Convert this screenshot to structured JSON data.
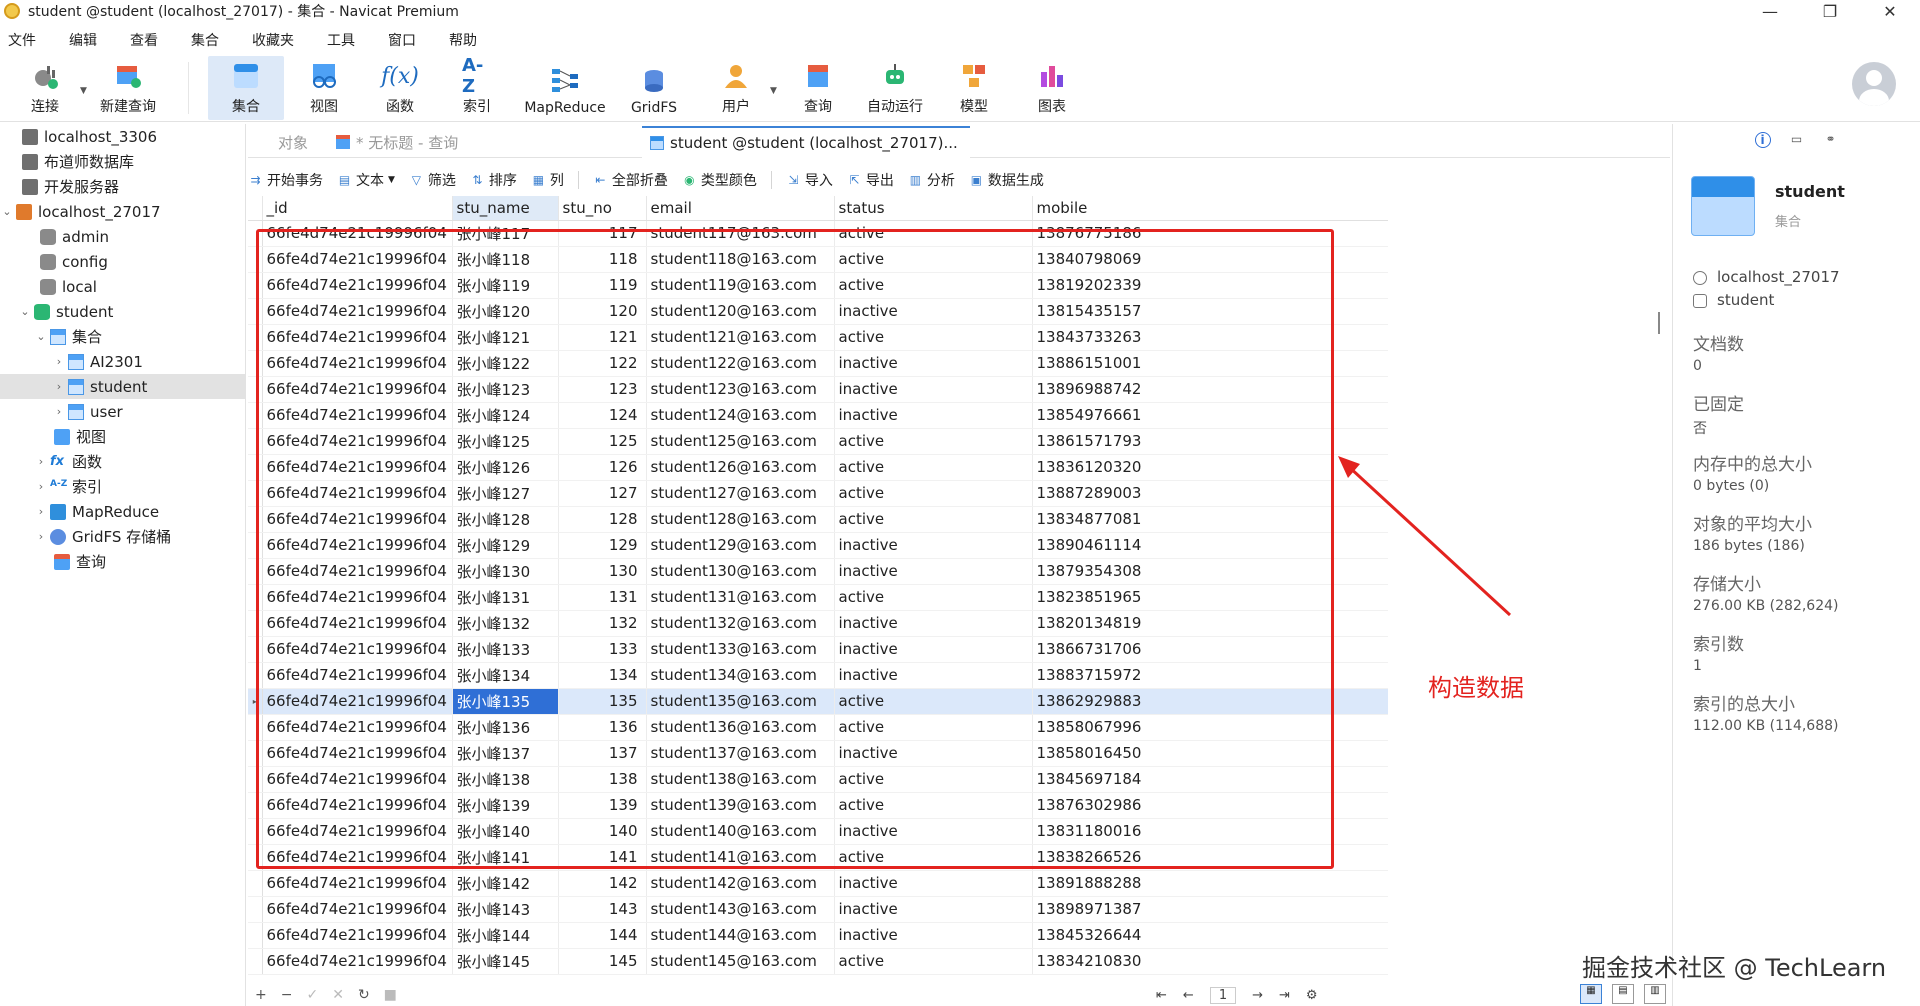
{
  "window": {
    "title": "student @student (localhost_27017) - 集合 - Navicat Premium",
    "controls": [
      "—",
      "❐",
      "✕"
    ]
  },
  "menu": [
    "文件",
    "编辑",
    "查看",
    "集合",
    "收藏夹",
    "工具",
    "窗口",
    "帮助"
  ],
  "toolbar": {
    "buttons": [
      {
        "label": "连接",
        "icon": "plug-icon"
      },
      {
        "label": "新建查询",
        "icon": "new-query-icon"
      },
      {
        "label": "集合",
        "icon": "collection-icon"
      },
      {
        "label": "视图",
        "icon": "view-icon"
      },
      {
        "label": "函数",
        "icon": "function-icon"
      },
      {
        "label": "索引",
        "icon": "index-icon"
      },
      {
        "label": "MapReduce",
        "icon": "mapreduce-icon"
      },
      {
        "label": "GridFS",
        "icon": "gridfs-icon"
      },
      {
        "label": "用户",
        "icon": "user-icon"
      },
      {
        "label": "查询",
        "icon": "query-icon"
      },
      {
        "label": "自动运行",
        "icon": "robot-icon"
      },
      {
        "label": "模型",
        "icon": "model-icon"
      },
      {
        "label": "图表",
        "icon": "chart-icon"
      }
    ],
    "accent": "#3b82d6"
  },
  "sidebar": {
    "items": [
      {
        "label": "localhost_3306"
      },
      {
        "label": "布道师数据库"
      },
      {
        "label": "开发服务器"
      },
      {
        "label": "localhost_27017"
      },
      {
        "label": "admin"
      },
      {
        "label": "config"
      },
      {
        "label": "local"
      },
      {
        "label": "student"
      },
      {
        "label": "集合"
      },
      {
        "label": "AI2301"
      },
      {
        "label": "student"
      },
      {
        "label": "user"
      },
      {
        "label": "视图"
      },
      {
        "label": "函数"
      },
      {
        "label": "索引"
      },
      {
        "label": "MapReduce"
      },
      {
        "label": "GridFS 存储桶"
      },
      {
        "label": "查询"
      }
    ]
  },
  "tabs": [
    {
      "label": "对象"
    },
    {
      "label": "* 无标题 - 查询"
    },
    {
      "label": "student @student (localhost_27017)..."
    }
  ],
  "data_toolbar": [
    "开始事务",
    "文本",
    "筛选",
    "排序",
    "列",
    "全部折叠",
    "类型颜色",
    "导入",
    "导出",
    "分析",
    "数据生成"
  ],
  "grid": {
    "columns": [
      "_id",
      "stu_name",
      "stu_no",
      "email",
      "status",
      "mobile"
    ],
    "id_prefix": "66fe4d74e21c19996f04",
    "rows": [
      [
        "66fe4d74e21c19996f04",
        "张小峰117",
        "117",
        "student117@163.com",
        "active",
        "13876775186"
      ],
      [
        "66fe4d74e21c19996f04",
        "张小峰118",
        "118",
        "student118@163.com",
        "active",
        "13840798069"
      ],
      [
        "66fe4d74e21c19996f04",
        "张小峰119",
        "119",
        "student119@163.com",
        "active",
        "13819202339"
      ],
      [
        "66fe4d74e21c19996f04",
        "张小峰120",
        "120",
        "student120@163.com",
        "inactive",
        "13815435157"
      ],
      [
        "66fe4d74e21c19996f04",
        "张小峰121",
        "121",
        "student121@163.com",
        "active",
        "13843733263"
      ],
      [
        "66fe4d74e21c19996f04",
        "张小峰122",
        "122",
        "student122@163.com",
        "inactive",
        "13886151001"
      ],
      [
        "66fe4d74e21c19996f04",
        "张小峰123",
        "123",
        "student123@163.com",
        "inactive",
        "13896988742"
      ],
      [
        "66fe4d74e21c19996f04",
        "张小峰124",
        "124",
        "student124@163.com",
        "inactive",
        "13854976661"
      ],
      [
        "66fe4d74e21c19996f04",
        "张小峰125",
        "125",
        "student125@163.com",
        "active",
        "13861571793"
      ],
      [
        "66fe4d74e21c19996f04",
        "张小峰126",
        "126",
        "student126@163.com",
        "active",
        "13836120320"
      ],
      [
        "66fe4d74e21c19996f04",
        "张小峰127",
        "127",
        "student127@163.com",
        "active",
        "13887289003"
      ],
      [
        "66fe4d74e21c19996f04",
        "张小峰128",
        "128",
        "student128@163.com",
        "active",
        "13834877081"
      ],
      [
        "66fe4d74e21c19996f04",
        "张小峰129",
        "129",
        "student129@163.com",
        "inactive",
        "13890461114"
      ],
      [
        "66fe4d74e21c19996f04",
        "张小峰130",
        "130",
        "student130@163.com",
        "inactive",
        "13879354308"
      ],
      [
        "66fe4d74e21c19996f04",
        "张小峰131",
        "131",
        "student131@163.com",
        "active",
        "13823851965"
      ],
      [
        "66fe4d74e21c19996f04",
        "张小峰132",
        "132",
        "student132@163.com",
        "inactive",
        "13820134819"
      ],
      [
        "66fe4d74e21c19996f04",
        "张小峰133",
        "133",
        "student133@163.com",
        "inactive",
        "13866731706"
      ],
      [
        "66fe4d74e21c19996f04",
        "张小峰134",
        "134",
        "student134@163.com",
        "inactive",
        "13883715972"
      ],
      [
        "66fe4d74e21c19996f04",
        "张小峰135",
        "135",
        "student135@163.com",
        "active",
        "13862929883"
      ],
      [
        "66fe4d74e21c19996f04",
        "张小峰136",
        "136",
        "student136@163.com",
        "active",
        "13858067996"
      ],
      [
        "66fe4d74e21c19996f04",
        "张小峰137",
        "137",
        "student137@163.com",
        "inactive",
        "13858016450"
      ],
      [
        "66fe4d74e21c19996f04",
        "张小峰138",
        "138",
        "student138@163.com",
        "active",
        "13845697184"
      ],
      [
        "66fe4d74e21c19996f04",
        "张小峰139",
        "139",
        "student139@163.com",
        "active",
        "13876302986"
      ],
      [
        "66fe4d74e21c19996f04",
        "张小峰140",
        "140",
        "student140@163.com",
        "inactive",
        "13831180016"
      ],
      [
        "66fe4d74e21c19996f04",
        "张小峰141",
        "141",
        "student141@163.com",
        "active",
        "13838266526"
      ],
      [
        "66fe4d74e21c19996f04",
        "张小峰142",
        "142",
        "student142@163.com",
        "inactive",
        "13891888288"
      ],
      [
        "66fe4d74e21c19996f04",
        "张小峰143",
        "143",
        "student143@163.com",
        "inactive",
        "13898971387"
      ],
      [
        "66fe4d74e21c19996f04",
        "张小峰144",
        "144",
        "student144@163.com",
        "inactive",
        "13845326644"
      ],
      [
        "66fe4d74e21c19996f04",
        "张小峰145",
        "145",
        "student145@163.com",
        "active",
        "13834210830"
      ]
    ],
    "selected_index": 18
  },
  "annotation": {
    "text": "构造数据",
    "color": "#e3231f"
  },
  "bottom_bar": {
    "buttons": [
      "+",
      "−",
      "✓",
      "✕",
      "↻",
      "■"
    ],
    "pager": [
      "⇤",
      "←",
      "1",
      "→",
      "⇥",
      "⚙"
    ]
  },
  "right_panel": {
    "name": "student",
    "type": "集合",
    "connection": "localhost_27017",
    "database": "student",
    "props": [
      {
        "k": "文档数",
        "v": "0"
      },
      {
        "k": "已固定",
        "v": "否"
      },
      {
        "k": "内存中的总大小",
        "v": "0 bytes (0)"
      },
      {
        "k": "对象的平均大小",
        "v": "186 bytes (186)"
      },
      {
        "k": "存储大小",
        "v": "276.00 KB (282,624)"
      },
      {
        "k": "索引数",
        "v": "1"
      },
      {
        "k": "索引的总大小",
        "v": "112.00 KB (114,688)"
      }
    ]
  },
  "watermark": "掘金技术社区 @ TechLearn"
}
